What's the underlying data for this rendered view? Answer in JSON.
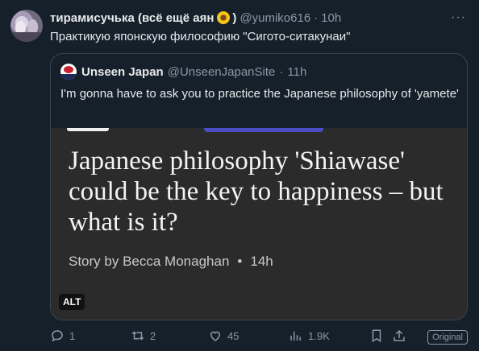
{
  "tweet": {
    "display_name": "тирамисучька (всё ещё аян",
    "display_name_suffix": ")",
    "emoji_icon": "sunflower-emoji",
    "handle": "@yumiko616",
    "separator": "·",
    "time": "10h",
    "more_icon": "more-dots-icon",
    "text": "Практикую японскую философию \"Сигото-ситакунаи\""
  },
  "quote": {
    "display_name": "Unseen Japan",
    "handle": "@UnseenJapanSite",
    "separator": "·",
    "time": "11h",
    "text": "I'm gonna have to ask you to practice the Japanese philosophy of 'yamete'",
    "card": {
      "headline": "Japanese philosophy 'Shiawase' could be the key to happiness – but what is it?",
      "byline_story": "Story by Becca Monaghan",
      "byline_dot": "•",
      "byline_time": "14h",
      "alt_label": "ALT"
    }
  },
  "actions": {
    "reply": {
      "icon": "reply-icon",
      "count": "1"
    },
    "retweet": {
      "icon": "retweet-icon",
      "count": "2"
    },
    "like": {
      "icon": "heart-icon",
      "count": "45"
    },
    "views": {
      "icon": "views-chart-icon",
      "count": "1.9K"
    },
    "bookmark": {
      "icon": "bookmark-icon"
    },
    "original_label": "Original"
  },
  "colors": {
    "background": "#15202b",
    "text_primary": "#e7e9ea",
    "text_secondary": "#8b98a5",
    "border": "#38444d",
    "card_background": "#2b2b2b"
  }
}
